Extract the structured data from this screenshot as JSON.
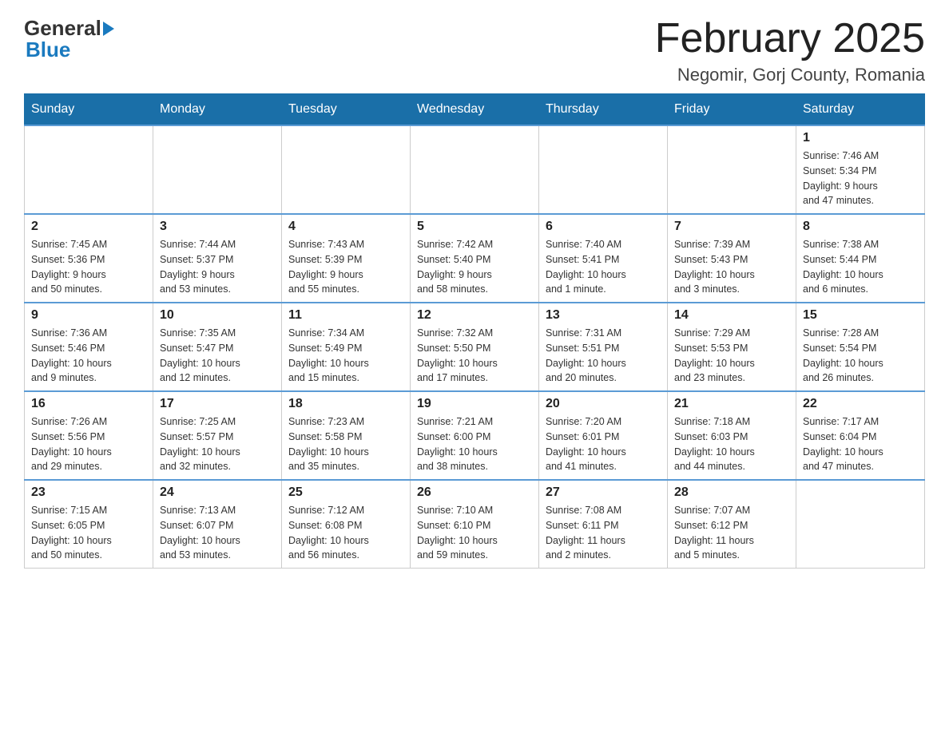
{
  "header": {
    "logo_text_general": "General",
    "logo_text_blue": "Blue",
    "month_title": "February 2025",
    "location": "Negomir, Gorj County, Romania"
  },
  "weekdays": [
    "Sunday",
    "Monday",
    "Tuesday",
    "Wednesday",
    "Thursday",
    "Friday",
    "Saturday"
  ],
  "weeks": [
    [
      {
        "day": "",
        "info": ""
      },
      {
        "day": "",
        "info": ""
      },
      {
        "day": "",
        "info": ""
      },
      {
        "day": "",
        "info": ""
      },
      {
        "day": "",
        "info": ""
      },
      {
        "day": "",
        "info": ""
      },
      {
        "day": "1",
        "info": "Sunrise: 7:46 AM\nSunset: 5:34 PM\nDaylight: 9 hours\nand 47 minutes."
      }
    ],
    [
      {
        "day": "2",
        "info": "Sunrise: 7:45 AM\nSunset: 5:36 PM\nDaylight: 9 hours\nand 50 minutes."
      },
      {
        "day": "3",
        "info": "Sunrise: 7:44 AM\nSunset: 5:37 PM\nDaylight: 9 hours\nand 53 minutes."
      },
      {
        "day": "4",
        "info": "Sunrise: 7:43 AM\nSunset: 5:39 PM\nDaylight: 9 hours\nand 55 minutes."
      },
      {
        "day": "5",
        "info": "Sunrise: 7:42 AM\nSunset: 5:40 PM\nDaylight: 9 hours\nand 58 minutes."
      },
      {
        "day": "6",
        "info": "Sunrise: 7:40 AM\nSunset: 5:41 PM\nDaylight: 10 hours\nand 1 minute."
      },
      {
        "day": "7",
        "info": "Sunrise: 7:39 AM\nSunset: 5:43 PM\nDaylight: 10 hours\nand 3 minutes."
      },
      {
        "day": "8",
        "info": "Sunrise: 7:38 AM\nSunset: 5:44 PM\nDaylight: 10 hours\nand 6 minutes."
      }
    ],
    [
      {
        "day": "9",
        "info": "Sunrise: 7:36 AM\nSunset: 5:46 PM\nDaylight: 10 hours\nand 9 minutes."
      },
      {
        "day": "10",
        "info": "Sunrise: 7:35 AM\nSunset: 5:47 PM\nDaylight: 10 hours\nand 12 minutes."
      },
      {
        "day": "11",
        "info": "Sunrise: 7:34 AM\nSunset: 5:49 PM\nDaylight: 10 hours\nand 15 minutes."
      },
      {
        "day": "12",
        "info": "Sunrise: 7:32 AM\nSunset: 5:50 PM\nDaylight: 10 hours\nand 17 minutes."
      },
      {
        "day": "13",
        "info": "Sunrise: 7:31 AM\nSunset: 5:51 PM\nDaylight: 10 hours\nand 20 minutes."
      },
      {
        "day": "14",
        "info": "Sunrise: 7:29 AM\nSunset: 5:53 PM\nDaylight: 10 hours\nand 23 minutes."
      },
      {
        "day": "15",
        "info": "Sunrise: 7:28 AM\nSunset: 5:54 PM\nDaylight: 10 hours\nand 26 minutes."
      }
    ],
    [
      {
        "day": "16",
        "info": "Sunrise: 7:26 AM\nSunset: 5:56 PM\nDaylight: 10 hours\nand 29 minutes."
      },
      {
        "day": "17",
        "info": "Sunrise: 7:25 AM\nSunset: 5:57 PM\nDaylight: 10 hours\nand 32 minutes."
      },
      {
        "day": "18",
        "info": "Sunrise: 7:23 AM\nSunset: 5:58 PM\nDaylight: 10 hours\nand 35 minutes."
      },
      {
        "day": "19",
        "info": "Sunrise: 7:21 AM\nSunset: 6:00 PM\nDaylight: 10 hours\nand 38 minutes."
      },
      {
        "day": "20",
        "info": "Sunrise: 7:20 AM\nSunset: 6:01 PM\nDaylight: 10 hours\nand 41 minutes."
      },
      {
        "day": "21",
        "info": "Sunrise: 7:18 AM\nSunset: 6:03 PM\nDaylight: 10 hours\nand 44 minutes."
      },
      {
        "day": "22",
        "info": "Sunrise: 7:17 AM\nSunset: 6:04 PM\nDaylight: 10 hours\nand 47 minutes."
      }
    ],
    [
      {
        "day": "23",
        "info": "Sunrise: 7:15 AM\nSunset: 6:05 PM\nDaylight: 10 hours\nand 50 minutes."
      },
      {
        "day": "24",
        "info": "Sunrise: 7:13 AM\nSunset: 6:07 PM\nDaylight: 10 hours\nand 53 minutes."
      },
      {
        "day": "25",
        "info": "Sunrise: 7:12 AM\nSunset: 6:08 PM\nDaylight: 10 hours\nand 56 minutes."
      },
      {
        "day": "26",
        "info": "Sunrise: 7:10 AM\nSunset: 6:10 PM\nDaylight: 10 hours\nand 59 minutes."
      },
      {
        "day": "27",
        "info": "Sunrise: 7:08 AM\nSunset: 6:11 PM\nDaylight: 11 hours\nand 2 minutes."
      },
      {
        "day": "28",
        "info": "Sunrise: 7:07 AM\nSunset: 6:12 PM\nDaylight: 11 hours\nand 5 minutes."
      },
      {
        "day": "",
        "info": ""
      }
    ]
  ]
}
